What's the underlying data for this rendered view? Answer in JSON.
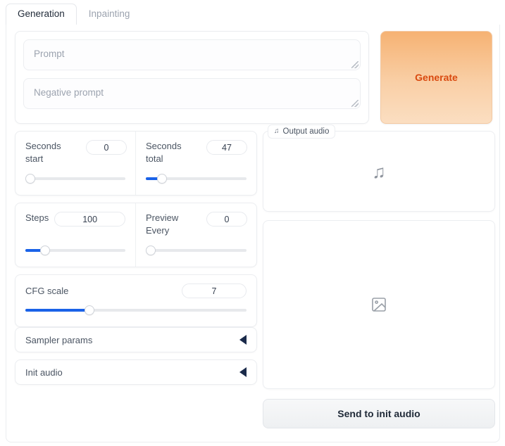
{
  "tabs": [
    {
      "label": "Generation",
      "active": true
    },
    {
      "label": "Inpainting",
      "active": false
    }
  ],
  "prompts": {
    "prompt_value": "",
    "prompt_placeholder": "Prompt",
    "negative_value": "",
    "negative_placeholder": "Negative prompt"
  },
  "generate": {
    "label": "Generate",
    "accent": "#d9490f",
    "bg_top": "#f6b273",
    "bg_bottom": "#fbdec1"
  },
  "controls": {
    "seconds_start": {
      "label": "Seconds start",
      "value": "0",
      "percent": 0
    },
    "seconds_total": {
      "label": "Seconds total",
      "value": "47",
      "percent": 16
    },
    "steps": {
      "label": "Steps",
      "value": "100",
      "percent": 20
    },
    "preview_every": {
      "label": "Preview Every",
      "value": "0",
      "percent": 0
    },
    "cfg_scale": {
      "label": "CFG scale",
      "value": "7",
      "percent": 29
    },
    "slider_fill_color": "#1a62e8",
    "slider_track_color": "#e7e9ec"
  },
  "accordions": [
    {
      "label": "Sampler params",
      "expanded": false,
      "arrow": "triangle-left-icon"
    },
    {
      "label": "Init audio",
      "expanded": false,
      "arrow": "triangle-left-icon"
    }
  ],
  "output": {
    "audio_label": "Output audio",
    "audio_label_icon": "music-note-icon",
    "audio_placeholder_icon": "music-note-icon",
    "audio_placeholder_glyph": "♫",
    "image_placeholder_icon": "image-placeholder-icon",
    "send_button_label": "Send to init audio"
  }
}
